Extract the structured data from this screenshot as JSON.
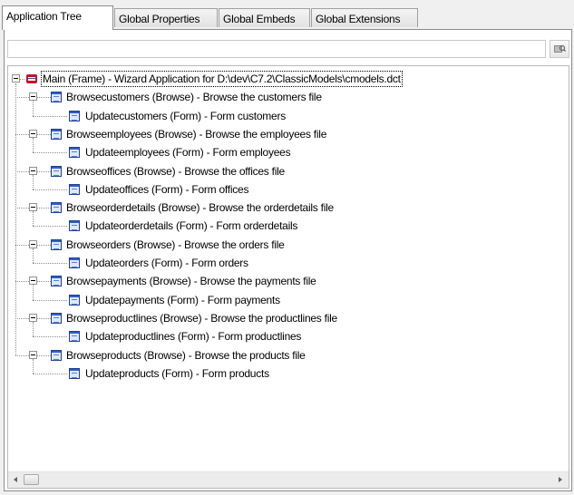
{
  "tabs": [
    {
      "label": "Application Tree",
      "active": true
    },
    {
      "label": "Global Properties",
      "active": false
    },
    {
      "label": "Global Embeds",
      "active": false
    },
    {
      "label": "Global Extensions",
      "active": false
    }
  ],
  "filter": {
    "value": "",
    "placeholder": ""
  },
  "tree": {
    "root": {
      "label": "Main (Frame) - Wizard Application for D:\\dev\\C7.2\\ClassicModels\\cmodels.dct",
      "icon": "frame-icon",
      "expanded": true,
      "selected": true
    },
    "groups": [
      {
        "browse": "Browsecustomers (Browse) - Browse the customers file",
        "form": "Updatecustomers (Form) - Form customers"
      },
      {
        "browse": "Browseemployees (Browse) - Browse the employees file",
        "form": "Updateemployees (Form) - Form employees"
      },
      {
        "browse": "Browseoffices (Browse) - Browse the offices file",
        "form": "Updateoffices (Form) - Form offices"
      },
      {
        "browse": "Browseorderdetails (Browse) - Browse the orderdetails file",
        "form": "Updateorderdetails (Form) - Form orderdetails"
      },
      {
        "browse": "Browseorders (Browse) - Browse the orders file",
        "form": "Updateorders (Form) - Form orders"
      },
      {
        "browse": "Browsepayments (Browse) - Browse the payments file",
        "form": "Updatepayments (Form) - Form payments"
      },
      {
        "browse": "Browseproductlines (Browse) - Browse the productlines file",
        "form": "Updateproductlines (Form) - Form productlines"
      },
      {
        "browse": "Browseproducts (Browse) - Browse the products file",
        "form": "Updateproducts (Form) - Form products"
      }
    ]
  },
  "icons": {
    "node_icon": "form-icon",
    "filter_button_icon": "filter-search-icon",
    "scroll_left": "scroll-left-arrow-icon",
    "scroll_right": "scroll-right-arrow-icon"
  },
  "colors": {
    "tree_lines": "#8f8f8f",
    "icon_blue": "#2f5fc6",
    "root_icon_red": "#c8102e"
  }
}
